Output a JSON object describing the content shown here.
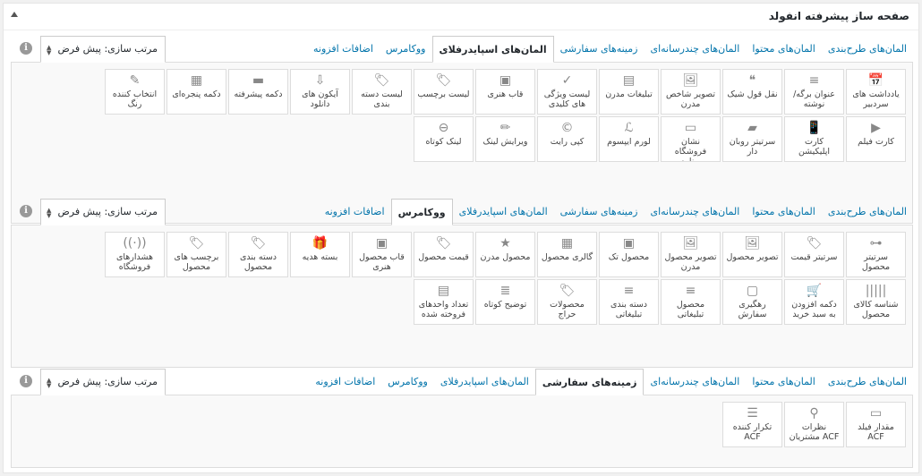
{
  "panel": {
    "title": "صفحه ساز پیشرفته انفولد"
  },
  "sort_label": "مرتب سازی: پیش فرض",
  "info_glyph": "i",
  "tabs": [
    "المان‌های طرح‌بندی",
    "المان‌های محتوا",
    "المان‌های چندرسانه‌ای",
    "زمینه‌های سفارشی",
    "المان‌های اسپایدرفلای",
    "ووکامرس",
    "اضافات افزونه"
  ],
  "sections": [
    {
      "active_tab": 4,
      "items": [
        {
          "label": "یادداشت های سردبیر",
          "icon": "calendar-icon",
          "glyph": "📅"
        },
        {
          "label": "عنوان برگه/نوشته",
          "icon": "heading-icon",
          "glyph": "≡"
        },
        {
          "label": "نقل قول شیک",
          "icon": "quote-icon",
          "glyph": "❝"
        },
        {
          "label": "تصویر شاخص مدرن",
          "icon": "image-icon",
          "glyph": "🖼"
        },
        {
          "label": "تبلیغات مدرن",
          "icon": "ad-icon",
          "glyph": "▤"
        },
        {
          "label": "لیست ویژگی های کلیدی",
          "icon": "check-circle-icon",
          "glyph": "✓"
        },
        {
          "label": "قاب هنری",
          "icon": "picture-icon",
          "glyph": "▣"
        },
        {
          "label": "لیست برچسب",
          "icon": "tag-icon",
          "glyph": "🏷"
        },
        {
          "label": "لیست دسته بندی",
          "icon": "tag-icon",
          "glyph": "🏷"
        },
        {
          "label": "آیکون های دانلود",
          "icon": "download-icon",
          "glyph": "⇩"
        },
        {
          "label": "دکمه پیشرفته",
          "icon": "button-icon",
          "glyph": "▬"
        },
        {
          "label": "دکمه پنجره‌ای",
          "icon": "window-icon",
          "glyph": "▦"
        },
        {
          "label": "انتخاب کننده رنگ",
          "icon": "eyedropper-icon",
          "glyph": "✎"
        },
        {
          "label": "کارت فیلم",
          "icon": "film-icon",
          "glyph": "▶"
        },
        {
          "label": "کارت اپلیکیشن",
          "icon": "phone-icon",
          "glyph": "📱"
        },
        {
          "label": "سرتیتر روبان دار",
          "icon": "ribbon-icon",
          "glyph": "▰"
        },
        {
          "label": "نشان فروشگاه برنامه",
          "icon": "badge-icon",
          "glyph": "▭"
        },
        {
          "label": "لورم ایپسوم",
          "icon": "script-icon",
          "glyph": "ℒ"
        },
        {
          "label": "کپی رایت",
          "icon": "copyright-icon",
          "glyph": "©"
        },
        {
          "label": "ویرایش لینک",
          "icon": "pencil-icon",
          "glyph": "✏"
        },
        {
          "label": "لینک کوتاه",
          "icon": "link-icon",
          "glyph": "⊖"
        }
      ]
    },
    {
      "active_tab": 5,
      "items": [
        {
          "label": "سرتیتر محصول",
          "icon": "key-icon",
          "glyph": "⊶"
        },
        {
          "label": "سرتیتر قیمت",
          "icon": "price-tag-icon",
          "glyph": "🏷"
        },
        {
          "label": "تصویر محصول",
          "icon": "image-icon",
          "glyph": "🖼"
        },
        {
          "label": "تصویر محصول مدرن",
          "icon": "image-icon",
          "glyph": "🖼"
        },
        {
          "label": "محصول تک",
          "icon": "box-icon",
          "glyph": "▣"
        },
        {
          "label": "گالری محصول",
          "icon": "grid-icon",
          "glyph": "▦"
        },
        {
          "label": "محصول مدرن",
          "icon": "star-icon",
          "glyph": "★"
        },
        {
          "label": "قیمت محصول",
          "icon": "price-tag-icon",
          "glyph": "🏷"
        },
        {
          "label": "قاب محصول هنری",
          "icon": "picture-icon",
          "glyph": "▣"
        },
        {
          "label": "بسته هدیه",
          "icon": "gift-icon",
          "glyph": "🎁"
        },
        {
          "label": "دسته بندی محصول",
          "icon": "tag-icon",
          "glyph": "🏷"
        },
        {
          "label": "برچسب های محصول",
          "icon": "tag-icon",
          "glyph": "🏷"
        },
        {
          "label": "هشدارهای فروشگاه",
          "icon": "broadcast-icon",
          "glyph": "((·))"
        },
        {
          "label": "شناسه کالای محصول",
          "icon": "barcode-icon",
          "glyph": "|||||"
        },
        {
          "label": "دکمه افزودن به سبد خرید",
          "icon": "cart-icon",
          "glyph": "🛒"
        },
        {
          "label": "رهگیری سفارش",
          "icon": "tracking-icon",
          "glyph": "▢"
        },
        {
          "label": "محصول تبلیغاتی",
          "icon": "list-icon",
          "glyph": "≡"
        },
        {
          "label": "دسته بندی تبلیغاتی",
          "icon": "list-icon",
          "glyph": "≡"
        },
        {
          "label": "محصولات حراج",
          "icon": "price-tag-icon",
          "glyph": "🏷"
        },
        {
          "label": "توضیح کوتاه",
          "icon": "text-circle-icon",
          "glyph": "≣"
        },
        {
          "label": "تعداد واحدهای فروخته شده",
          "icon": "units-icon",
          "glyph": "▤"
        }
      ]
    },
    {
      "active_tab": 3,
      "items": [
        {
          "label": "مقدار فیلد ACF",
          "icon": "field-icon",
          "glyph": "▭"
        },
        {
          "label": "نظرات مشتریان ACF",
          "icon": "stamp-icon",
          "glyph": "⚲"
        },
        {
          "label": "تکرار کننده ACF",
          "icon": "stack-icon",
          "glyph": "☰"
        }
      ]
    }
  ]
}
